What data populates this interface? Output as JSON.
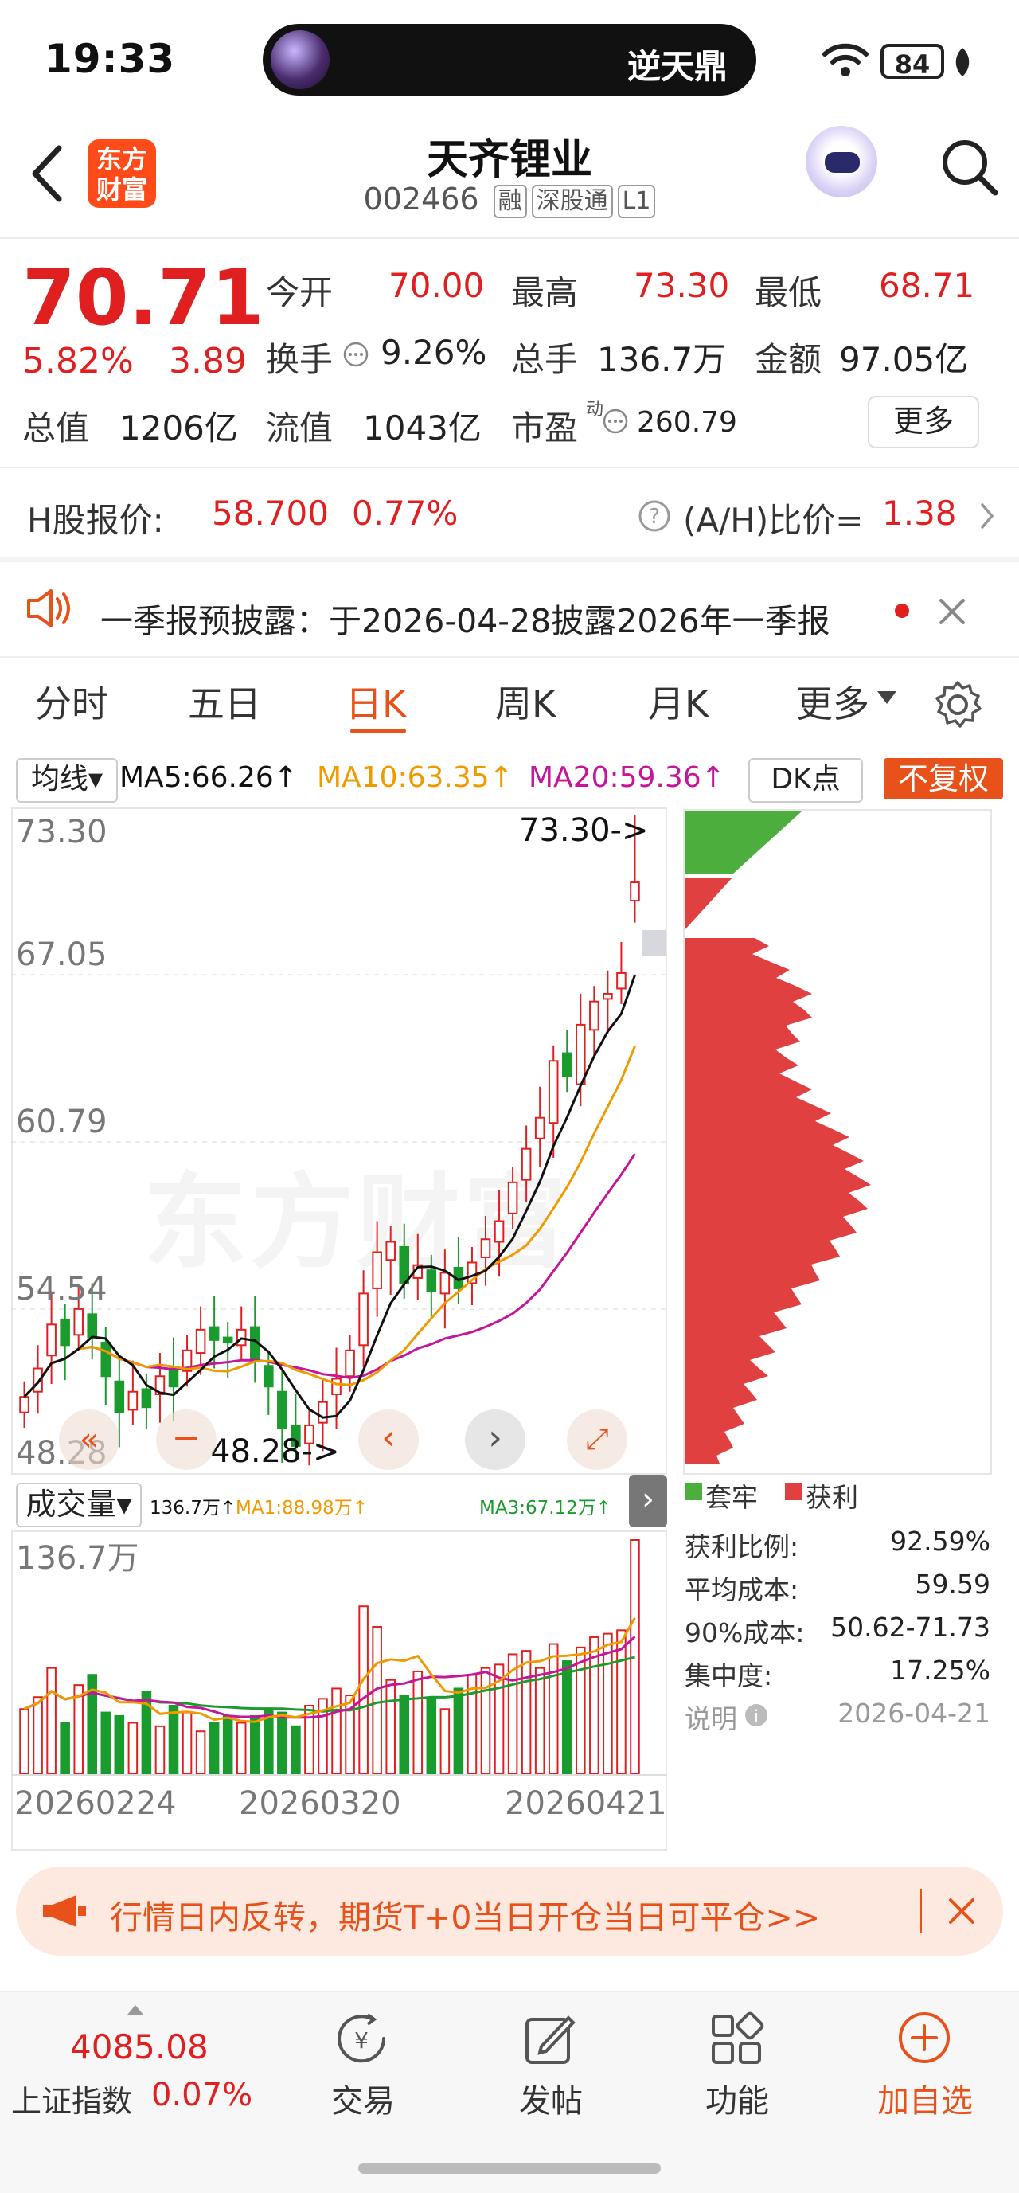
{
  "status_bar": {
    "time": "19:33",
    "island_text": "逆天鼎",
    "battery": "84"
  },
  "header": {
    "logo_line1": "东方",
    "logo_line2": "财富",
    "stock_name": "天齐锂业",
    "stock_code": "002466",
    "tags": [
      "融",
      "深股通",
      "L1"
    ]
  },
  "quote": {
    "price": "70.71",
    "change_pct": "5.82%",
    "change_amt": "3.89",
    "open_label": "今开",
    "open": "70.00",
    "high_label": "最高",
    "high": "73.30",
    "low_label": "最低",
    "low": "68.71",
    "turnover_label": "换手",
    "turnover": "9.26%",
    "volume_label": "总手",
    "volume": "136.7万",
    "amount_label": "金额",
    "amount": "97.05亿",
    "mcap_label": "总值",
    "mcap": "1206亿",
    "float_label": "流值",
    "float": "1043亿",
    "pe_label": "市盈",
    "pe_sup": "动",
    "pe": "260.79",
    "more": "更多"
  },
  "h_share": {
    "label": "H股报价:",
    "price": "58.700",
    "pct": "0.77%",
    "ah_label": "(A/H)比价=",
    "ah_value": "1.38"
  },
  "notice": {
    "text": "一季报预披露：于2026-04-28披露2026年一季报"
  },
  "tabs": [
    "分时",
    "五日",
    "日K",
    "周K",
    "月K",
    "更多"
  ],
  "ma_row": {
    "selector": "均线",
    "ma5": "MA5:66.26↑",
    "ma10": "MA10:63.35↑",
    "ma20": "MA20:59.36↑",
    "dk": "DK点",
    "adjust": "不复权"
  },
  "kline": {
    "y_labels": [
      "73.30",
      "67.05",
      "60.79",
      "54.54",
      "48.28"
    ],
    "max_marker": "73.30->",
    "min_marker": "48.28->",
    "watermark": "东方财富"
  },
  "volume": {
    "selector": "成交量",
    "vol": "136.7万↑",
    "ma1": "MA1:88.98万↑",
    "ma3": "MA3:67.12万↑",
    "y_label": "136.7万",
    "dates": [
      "20260224",
      "20260320",
      "20260421"
    ]
  },
  "chips": {
    "legend_trapped": "套牢",
    "legend_profit": "获利",
    "stats": [
      {
        "label": "获利比例:",
        "value": "92.59%"
      },
      {
        "label": "平均成本:",
        "value": "59.59"
      },
      {
        "label": "90%成本:",
        "value": "50.62-71.73"
      },
      {
        "label": "集中度:",
        "value": "17.25%"
      },
      {
        "label": "说明",
        "value": "2026-04-21"
      }
    ]
  },
  "banner": {
    "text": "行情日内反转，期货T+0当日开仓当日可平仓>>"
  },
  "bottom_nav": {
    "index_value": "4085.08",
    "index_name": "上证指数",
    "index_pct": "0.07%",
    "items": [
      "交易",
      "发帖",
      "功能",
      "加自选"
    ]
  },
  "colors": {
    "up": "#e02020",
    "down": "#1a9b2e",
    "accent": "#e8511a",
    "ma5": "#111111",
    "ma10": "#f19a00",
    "ma20": "#c4169a"
  }
}
